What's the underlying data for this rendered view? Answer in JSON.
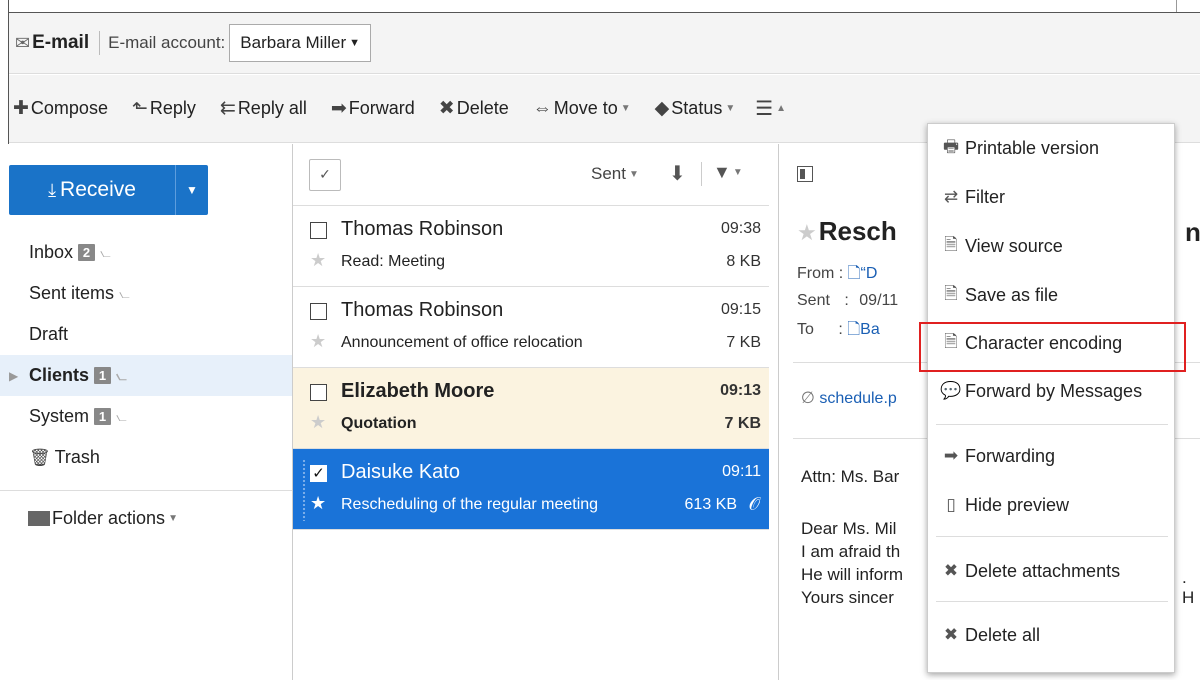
{
  "header": {
    "app_title": "E-mail",
    "account_label": "E-mail account:",
    "account_value": "Barbara Miller"
  },
  "toolbar": {
    "compose": "Compose",
    "reply": "Reply",
    "reply_all": "Reply all",
    "forward": "Forward",
    "delete": "Delete",
    "move_to": "Move to",
    "status": "Status"
  },
  "sidebar": {
    "receive_label": "Receive",
    "folders": [
      {
        "label": "Inbox",
        "badge": "2"
      },
      {
        "label": "Sent items"
      },
      {
        "label": "Draft"
      },
      {
        "label": "Clients",
        "badge": "1"
      },
      {
        "label": "System",
        "badge": "1"
      },
      {
        "label": "Trash"
      }
    ],
    "folder_actions": "Folder actions"
  },
  "list": {
    "sort_label": "Sent",
    "messages": [
      {
        "from": "Thomas Robinson",
        "time": "09:38",
        "subject": "Read: Meeting",
        "size": "8 KB"
      },
      {
        "from": "Thomas Robinson",
        "time": "09:15",
        "subject": "Announcement of office relocation",
        "size": "7 KB"
      },
      {
        "from": "Elizabeth Moore",
        "time": "09:13",
        "subject": "Quotation",
        "size": "7 KB"
      },
      {
        "from": "Daisuke Kato",
        "time": "09:11",
        "subject": "Rescheduling of the regular meeting",
        "size": "613 KB"
      }
    ]
  },
  "preview": {
    "title": "Resch",
    "title_tail": "n",
    "from_label": "From :",
    "from_value": "“D",
    "sent_label": "Sent",
    "sent_value": "09/11",
    "to_label": "To",
    "to_value": "Ba",
    "attachment": "schedule.p",
    "body": [
      "Attn: Ms. Bar",
      "Dear Ms. Mil",
      "I am afraid th",
      "He will inform",
      "Yours sincer"
    ],
    "body_tail": ". H"
  },
  "menu": {
    "items": [
      {
        "label": "Printable version",
        "icon": "printer-icon"
      },
      {
        "label": "Filter",
        "icon": "filter-icon"
      },
      {
        "label": "View source",
        "icon": "document-icon"
      },
      {
        "label": "Save as file",
        "icon": "document-icon"
      },
      {
        "label": "Character encoding",
        "icon": "document-icon"
      },
      {
        "label": "Forward by Messages",
        "icon": "messages-icon"
      },
      {
        "label": "Forwarding",
        "icon": "arrow-right-icon"
      },
      {
        "label": "Hide preview",
        "icon": "panel-icon"
      },
      {
        "label": "Delete attachments",
        "icon": "x-icon"
      },
      {
        "label": "Delete all",
        "icon": "x-icon"
      }
    ]
  },
  "colors": {
    "accent": "#1a73c8",
    "selected_row": "#1a73d8",
    "unread_row": "#fbf3e0",
    "highlight_border": "#e02020"
  }
}
